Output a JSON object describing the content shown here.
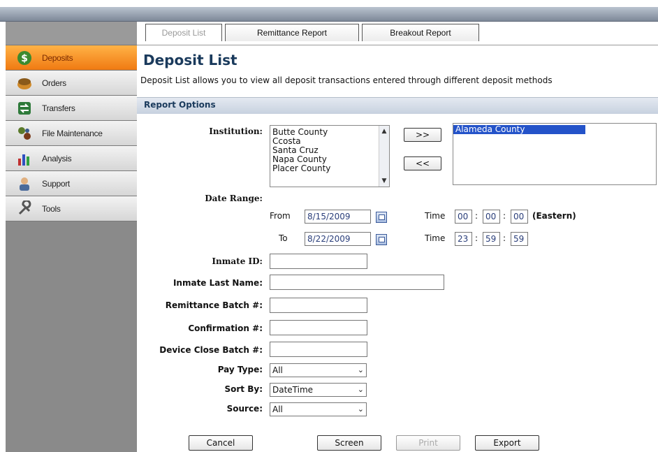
{
  "tabs": {
    "deposit_list": "Deposit List",
    "remittance_report": "Remittance Report",
    "breakout_report": "Breakout Report"
  },
  "sidebar": {
    "items": [
      {
        "label": "Deposits",
        "icon": "dollar-icon",
        "active": true
      },
      {
        "label": "Orders",
        "icon": "orders-icon"
      },
      {
        "label": "Transfers",
        "icon": "transfers-icon"
      },
      {
        "label": "File Maintenance",
        "icon": "file-maintenance-icon"
      },
      {
        "label": "Analysis",
        "icon": "analysis-chart-icon"
      },
      {
        "label": "Support",
        "icon": "support-person-icon"
      },
      {
        "label": "Tools",
        "icon": "tools-wrench-icon"
      }
    ]
  },
  "page": {
    "title": "Deposit List",
    "description": "Deposit List allows you to view all deposit transactions entered through different deposit methods",
    "section_header": "Report Options"
  },
  "form": {
    "institution_label": "Institution:",
    "institution_options": [
      "Butte County",
      "Ccosta",
      "Santa Cruz",
      "Napa County",
      "Placer County"
    ],
    "selected_institutions": [
      "Alameda County"
    ],
    "add_button": ">>",
    "remove_button": "<<",
    "date_range_label": "Date Range:",
    "from_label": "From",
    "to_label": "To",
    "from_date": "8/15/2009",
    "to_date": "8/22/2009",
    "time_label": "Time",
    "from_time": {
      "h": "00",
      "m": "00",
      "s": "00"
    },
    "to_time": {
      "h": "23",
      "m": "59",
      "s": "59"
    },
    "timezone": "(Eastern)",
    "colon": ":",
    "inmate_id_label": "Inmate ID:",
    "inmate_last_name_label": "Inmate Last Name:",
    "remittance_batch_label": "Remittance Batch #:",
    "confirmation_label": "Confirmation #:",
    "device_close_batch_label": "Device Close Batch #:",
    "pay_type_label": "Pay Type:",
    "pay_type_value": "All",
    "sort_by_label": "Sort By:",
    "sort_by_value": "DateTime",
    "source_label": "Source:",
    "source_value": "All"
  },
  "buttons": {
    "cancel": "Cancel",
    "screen": "Screen",
    "print": "Print",
    "export": "Export"
  },
  "colors": {
    "accent_orange": "#f07a12",
    "title_blue": "#1a3a5c",
    "selection_blue": "#2453c9"
  }
}
